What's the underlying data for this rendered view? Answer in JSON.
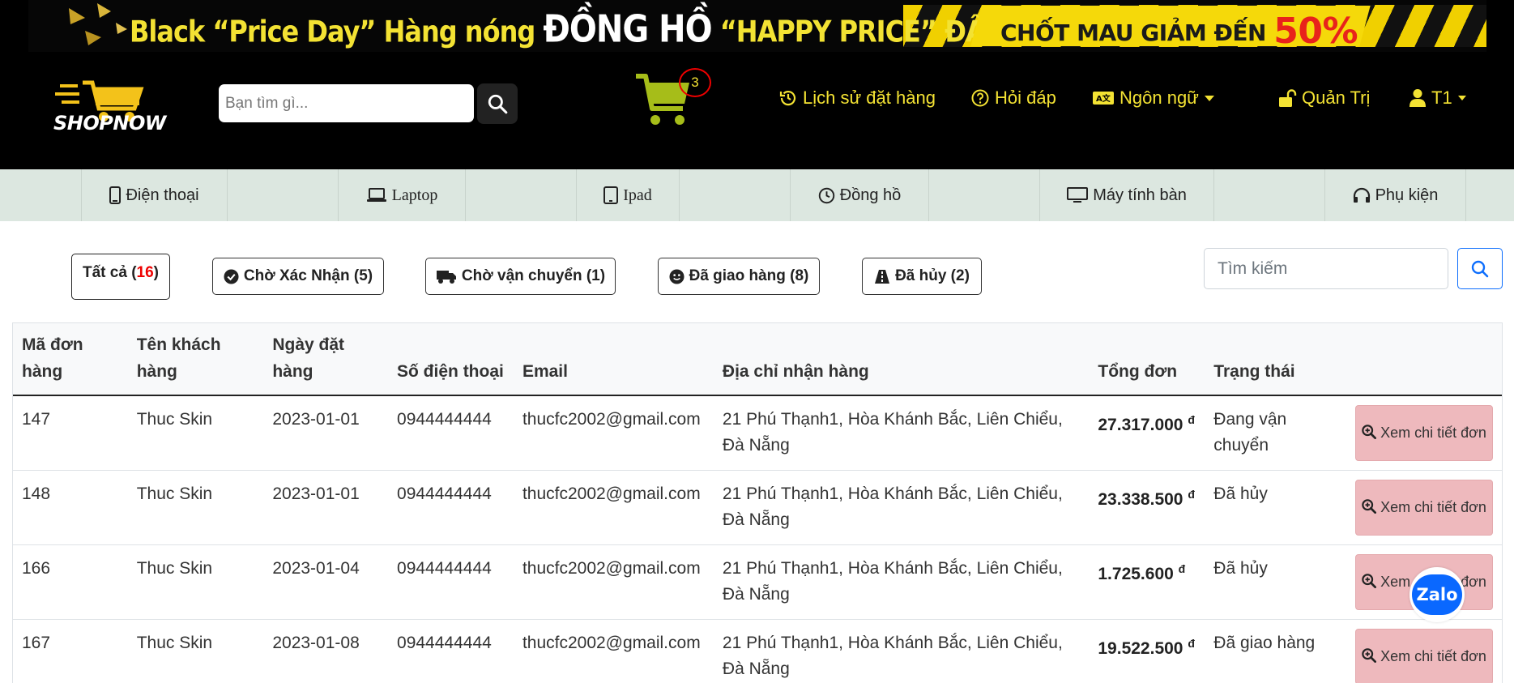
{
  "banner": {
    "headline_left": "Black “Price Day” Hàng nóng",
    "headline_white": "ĐỒNG HỒ",
    "headline_right": "“HAPPY PRICE” ĐÂY",
    "promo_text": "CHỐT MAU GIẢM ĐẾN",
    "promo_pct": "50%"
  },
  "logo": {
    "text": "SHOPNOW"
  },
  "search": {
    "placeholder": "Bạn tìm gì..."
  },
  "cart": {
    "count": "3"
  },
  "nav": {
    "history": "Lịch sử đặt hàng",
    "faq": "Hỏi đáp",
    "language": "Ngôn ngữ",
    "admin": "Quản Trị",
    "user": "T1"
  },
  "categories": [
    {
      "label": "Điện thoại",
      "icon": "phone-icon"
    },
    {
      "label": "Laptop",
      "icon": "laptop-icon"
    },
    {
      "label": "Ipad",
      "icon": "tablet-icon"
    },
    {
      "label": "Đồng hồ",
      "icon": "clock-icon"
    },
    {
      "label": "Máy tính bàn",
      "icon": "desktop-icon"
    },
    {
      "label": "Phụ kiện",
      "icon": "headphones-icon"
    }
  ],
  "filters": {
    "all": {
      "label": "Tất cả",
      "count": "16"
    },
    "pending": "Chờ Xác Nhận (5)",
    "shipping": "Chờ vận chuyển (1)",
    "delivered": "Đã giao hàng (8)",
    "cancelled": "Đã hủy (2)"
  },
  "table_search": {
    "placeholder": "Tìm kiếm"
  },
  "table": {
    "headers": {
      "id": "Mã đơn hàng",
      "customer": "Tên khách hàng",
      "date": "Ngày đặt hàng",
      "phone": "Số điện thoại",
      "email": "Email",
      "address": "Địa chỉ nhận hàng",
      "total": "Tổng đơn",
      "status": "Trạng thái"
    },
    "detail_label": "Xem chi tiết đơn",
    "currency": "đ",
    "rows": [
      {
        "id": "147",
        "customer": "Thuc Skin",
        "date": "2023-01-01",
        "phone": "0944444444",
        "email": "thucfc2002@gmail.com",
        "address": "21 Phú Thạnh1, Hòa Khánh Bắc, Liên Chiểu, Đà Nẵng",
        "total": "27.317.000",
        "status": "Đang vận chuyển"
      },
      {
        "id": "148",
        "customer": "Thuc Skin",
        "date": "2023-01-01",
        "phone": "0944444444",
        "email": "thucfc2002@gmail.com",
        "address": "21 Phú Thạnh1, Hòa Khánh Bắc, Liên Chiểu, Đà Nẵng",
        "total": "23.338.500",
        "status": "Đã hủy"
      },
      {
        "id": "166",
        "customer": "Thuc Skin",
        "date": "2023-01-04",
        "phone": "0944444444",
        "email": "thucfc2002@gmail.com",
        "address": "21 Phú Thạnh1, Hòa Khánh Bắc, Liên Chiểu, Đà Nẵng",
        "total": "1.725.600",
        "status": "Đã hủy"
      },
      {
        "id": "167",
        "customer": "Thuc Skin",
        "date": "2023-01-08",
        "phone": "0944444444",
        "email": "thucfc2002@gmail.com",
        "address": "21 Phú Thạnh1, Hòa Khánh Bắc, Liên Chiểu, Đà Nẵng",
        "total": "19.522.500",
        "status": "Đã giao hàng"
      }
    ]
  },
  "zalo": {
    "label": "Zalo"
  },
  "colors": {
    "accent_yellow": "#f3e233",
    "header_bg": "#000000",
    "category_bg": "#dce7e0",
    "detail_btn": "#eeb9bd",
    "primary": "#0d6efd",
    "badge_red": "#e00000"
  }
}
